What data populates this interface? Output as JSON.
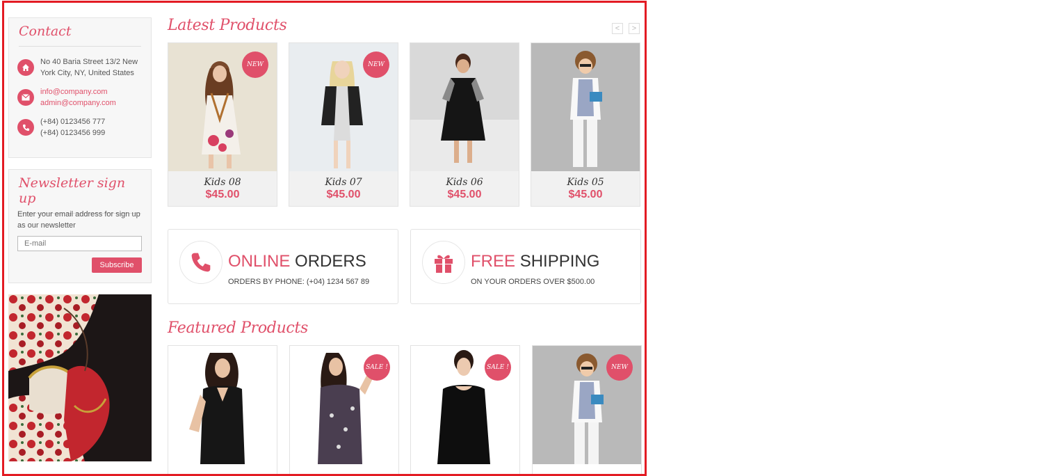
{
  "contact": {
    "title": "Contact",
    "address": "No 40 Baria Street 13/2 New York City, NY, United States",
    "email1": "info@company.com",
    "email2": "admin@company.com",
    "phone1": "(+84) 0123456 777",
    "phone2": "(+84) 0123456 999",
    "icons": [
      "home-icon",
      "envelope-icon",
      "phone-icon"
    ]
  },
  "newsletter": {
    "title": "Newsletter sign up",
    "text": "Enter your email address for sign up as our newsletter",
    "placeholder": "E-mail",
    "button": "Subscribe"
  },
  "latest": {
    "title": "Latest Products",
    "products": [
      {
        "name": "Kids 08",
        "price": "$45.00",
        "badge": "NEW"
      },
      {
        "name": "Kids 07",
        "price": "$45.00",
        "badge": "NEW"
      },
      {
        "name": "Kids 06",
        "price": "$45.00",
        "badge": ""
      },
      {
        "name": "Kids 05",
        "price": "$45.00",
        "badge": ""
      }
    ]
  },
  "services": [
    {
      "highlight": "ONLINE",
      "rest": "ORDERS",
      "sub": "ORDERS BY PHONE: (+04) 1234 567 89",
      "icon": "phone-icon"
    },
    {
      "highlight": "FREE",
      "rest": "SHIPPING",
      "sub": "ON YOUR ORDERS OVER $500.00",
      "icon": "gift-icon"
    }
  ],
  "featured": {
    "title": "Featured Products",
    "badges": [
      "",
      "SALE !",
      "SALE !",
      "NEW"
    ]
  },
  "colors": {
    "accent": "#e0506a",
    "frame": "#e31b23"
  }
}
